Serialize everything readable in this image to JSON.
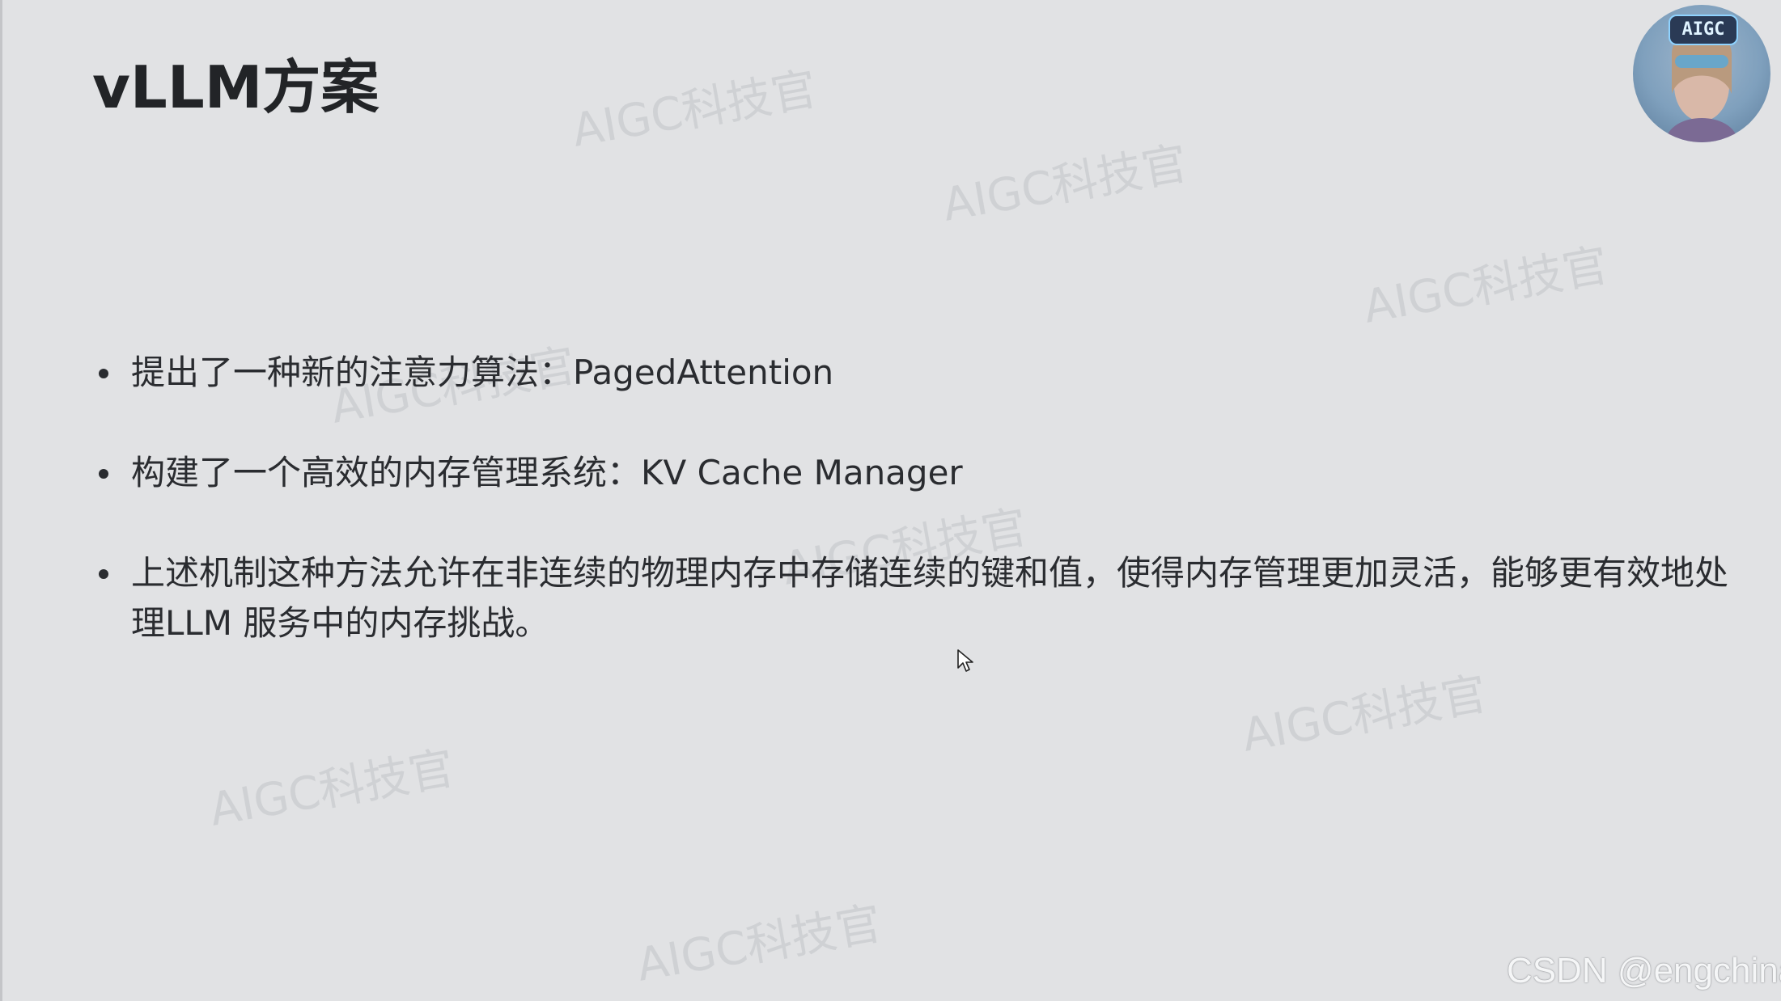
{
  "slide": {
    "title": "vLLM方案",
    "bullets": [
      "提出了一种新的注意力算法：PagedAttention",
      "构建了一个高效的内存管理系统：KV Cache Manager",
      "上述机制这种方法允许在非连续的物理内存中存储连续的键和值，使得内存管理更加灵活，能够更有效地处理LLM 服务中的内存挑战。"
    ]
  },
  "watermark": {
    "text": "AIGC科技官"
  },
  "avatar": {
    "badge": "AIGC"
  },
  "footer": {
    "credit": "CSDN @engchina"
  },
  "icons": {
    "cursor": "mouse-pointer-icon",
    "avatar": "avatar-image"
  },
  "colors": {
    "background": "#e1e2e4",
    "text": "#2a2c30",
    "title": "#222427"
  }
}
